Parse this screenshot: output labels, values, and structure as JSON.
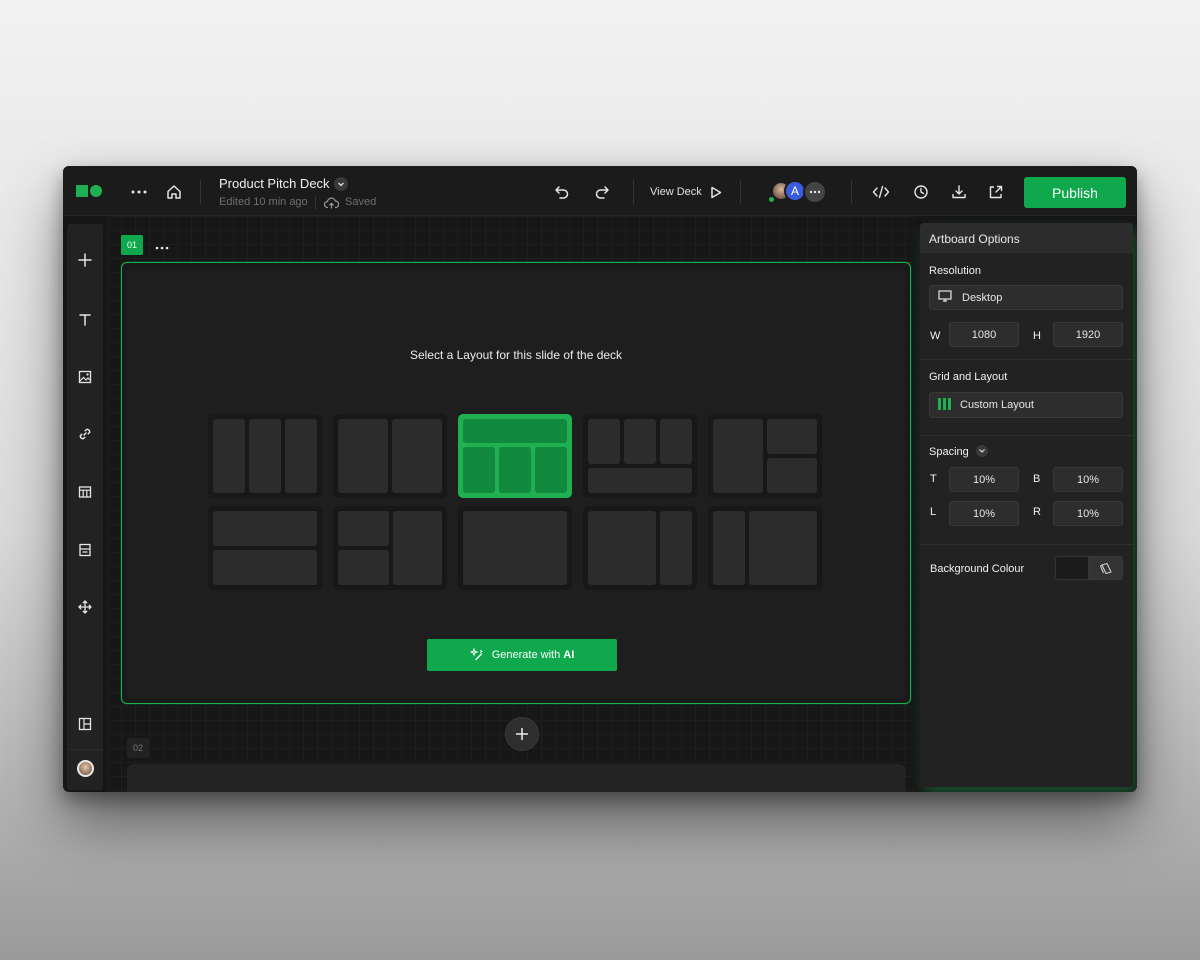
{
  "topbar": {
    "title": "Product Pitch Deck",
    "edited": "Edited 10 min ago",
    "saved": "Saved",
    "view_deck": "View Deck",
    "collaborator_initial": "A",
    "publish": "Publish"
  },
  "canvas": {
    "slide1_number": "01",
    "slide2_number": "02",
    "prompt": "Select a Layout for this slide of the deck",
    "generate_prefix": "Generate with ",
    "generate_bold": "AI",
    "selected_layout_index": 2
  },
  "panel": {
    "header": "Artboard Options",
    "resolution_label": "Resolution",
    "resolution_value": "Desktop",
    "w_label": "W",
    "w_value": "1080",
    "h_label": "H",
    "h_value": "1920",
    "grid_label": "Grid and Layout",
    "grid_value": "Custom Layout",
    "spacing_label": "Spacing",
    "t_label": "T",
    "t_value": "10%",
    "b_label": "B",
    "b_value": "10%",
    "l_label": "L",
    "l_value": "10%",
    "r_label": "R",
    "r_value": "10%",
    "bg_label": "Background Colour"
  },
  "colors": {
    "accent": "#0FA84D",
    "avatar_blue": "#3B5CE0"
  },
  "icons": {
    "rail": [
      "plus-icon",
      "text-icon",
      "image-icon",
      "link-icon",
      "table-icon",
      "section-icon",
      "move-icon",
      "layout-icon"
    ],
    "toolbar": [
      "more-icon",
      "home-icon",
      "undo-icon",
      "redo-icon",
      "play-icon",
      "code-icon",
      "history-icon",
      "download-icon",
      "share-icon"
    ]
  }
}
